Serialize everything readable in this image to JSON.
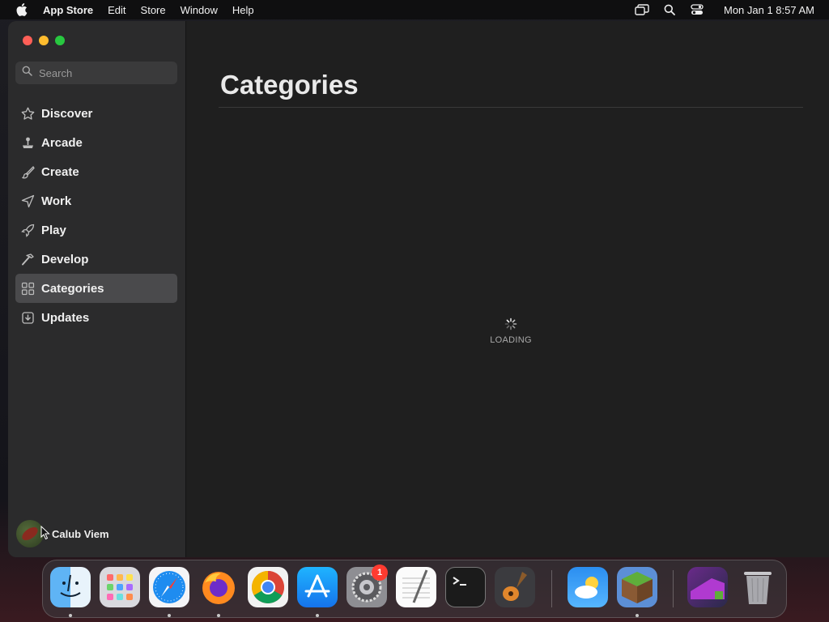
{
  "menubar": {
    "app_name": "App Store",
    "items": [
      "Edit",
      "Store",
      "Window",
      "Help"
    ],
    "clock": "Mon Jan 1  8:57 AM"
  },
  "sidebar": {
    "search_placeholder": "Search",
    "items": [
      {
        "label": "Discover",
        "icon": "star-icon"
      },
      {
        "label": "Arcade",
        "icon": "joystick-icon"
      },
      {
        "label": "Create",
        "icon": "brush-icon"
      },
      {
        "label": "Work",
        "icon": "paper-plane-icon"
      },
      {
        "label": "Play",
        "icon": "rocket-icon"
      },
      {
        "label": "Develop",
        "icon": "hammer-icon"
      },
      {
        "label": "Categories",
        "icon": "grid-icon",
        "selected": true
      },
      {
        "label": "Updates",
        "icon": "download-icon"
      }
    ],
    "user_name": "Calub Viem"
  },
  "main": {
    "title": "Categories",
    "loading_label": "LOADING"
  },
  "dock": {
    "apps": [
      "Finder",
      "Launchpad",
      "Safari",
      "Firefox",
      "Chrome",
      "App Store",
      "System Settings",
      "TextEdit",
      "Terminal",
      "GarageBand",
      "Weather",
      "Minecraft",
      "Photo",
      "Trash"
    ],
    "system_settings_badge": "1"
  },
  "colors": {
    "accent_selected": "#4a4a4c",
    "close": "#ff5f57",
    "minimize": "#febc2e",
    "maximize": "#28c840",
    "badge": "#ff3b30"
  }
}
